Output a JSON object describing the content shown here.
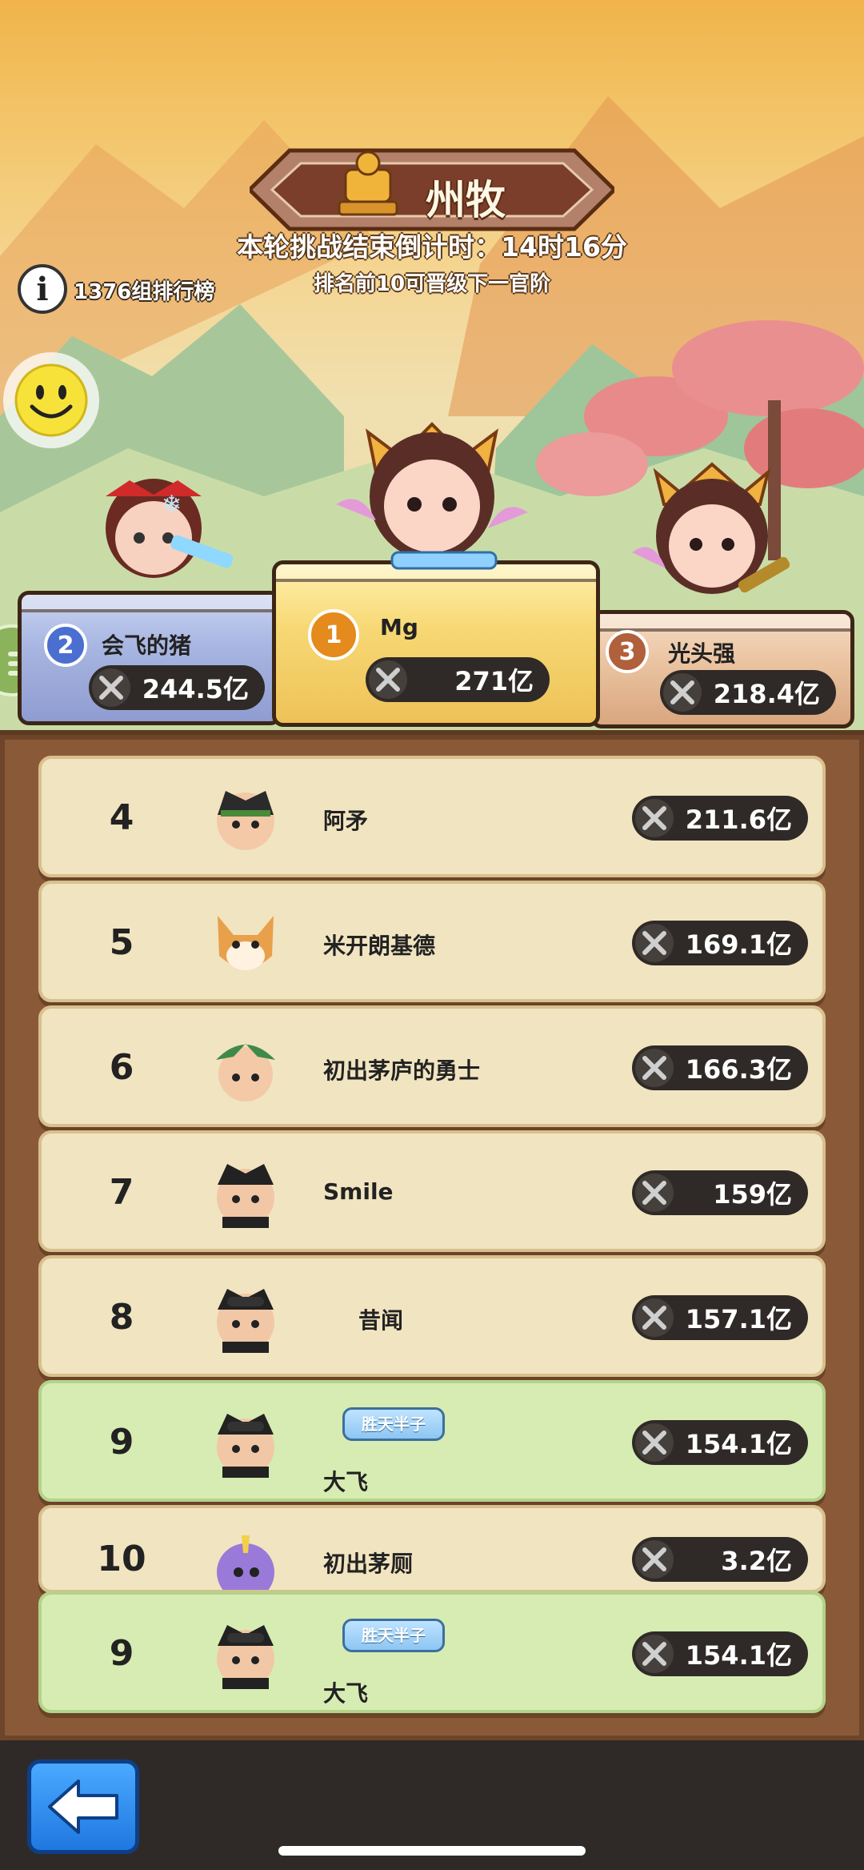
{
  "header": {
    "title": "州牧",
    "countdown": "本轮挑战结束倒计时：14时16分",
    "promotion_note": "排名前10可晋级下一官阶",
    "group_label": "1376组排行榜",
    "info_icon": "info-icon"
  },
  "podium": [
    {
      "rank": "1",
      "name": "Mg",
      "power": "271亿",
      "medal_color": "#e58a1c"
    },
    {
      "rank": "2",
      "name": "会飞的猪",
      "power": "244.5亿",
      "medal_color": "#4a6fd0"
    },
    {
      "rank": "3",
      "name": "光头强",
      "power": "218.4亿",
      "medal_color": "#b0603a"
    }
  ],
  "ranking": [
    {
      "rank": "4",
      "name": "阿矛",
      "power": "211.6亿"
    },
    {
      "rank": "5",
      "name": "米开朗基德",
      "power": "169.1亿"
    },
    {
      "rank": "6",
      "name": "初出茅庐的勇士",
      "power": "166.3亿"
    },
    {
      "rank": "7",
      "name": "Smile",
      "power": "159亿"
    },
    {
      "rank": "8",
      "name": "昔闻",
      "power": "157.1亿"
    },
    {
      "rank": "9",
      "name": "大飞",
      "power": "154.1亿",
      "title_badge": "胜天半子"
    },
    {
      "rank": "10",
      "name": "初出茅厕",
      "power": "3.2亿"
    }
  ],
  "my_rank": {
    "rank": "9",
    "name": "大飞",
    "power": "154.1亿",
    "title_badge": "胜天半子"
  },
  "colors": {
    "panel": "#8a5a38",
    "row": "#f1e4c0",
    "highlight_row": "#d7ecb2"
  }
}
